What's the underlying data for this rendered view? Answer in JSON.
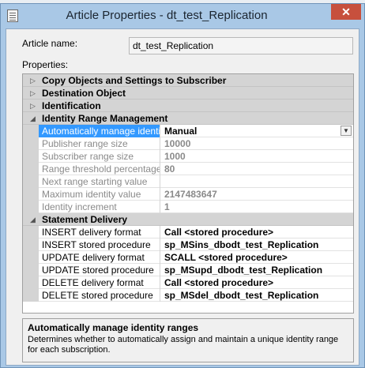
{
  "window": {
    "title": "Article Properties - dt_test_Replication",
    "close_label": "✕"
  },
  "form": {
    "article_name_label": "Article name:",
    "article_name_value": "dt_test_Replication",
    "properties_label": "Properties:"
  },
  "grid": {
    "categories": {
      "copy_objects": "Copy Objects and Settings to Subscriber",
      "destination_object": "Destination Object",
      "identification": "Identification",
      "identity_range": "Identity Range Management",
      "statement_delivery": "Statement Delivery"
    },
    "identity": [
      {
        "name": "Automatically manage identity ra",
        "value": "Manual"
      },
      {
        "name": "Publisher range size",
        "value": "10000"
      },
      {
        "name": "Subscriber range size",
        "value": "1000"
      },
      {
        "name": "Range threshold percentage",
        "value": "80"
      },
      {
        "name": "Next range starting value",
        "value": ""
      },
      {
        "name": "Maximum identity value",
        "value": "2147483647"
      },
      {
        "name": "Identity increment",
        "value": "1"
      }
    ],
    "statement": [
      {
        "name": "INSERT delivery format",
        "value": "Call <stored procedure>"
      },
      {
        "name": "INSERT stored procedure",
        "value": "sp_MSins_dbodt_test_Replication"
      },
      {
        "name": "UPDATE delivery format",
        "value": "SCALL <stored procedure>"
      },
      {
        "name": "UPDATE stored procedure",
        "value": "sp_MSupd_dbodt_test_Replication"
      },
      {
        "name": "DELETE delivery format",
        "value": "Call <stored procedure>"
      },
      {
        "name": "DELETE stored procedure",
        "value": "sp_MSdel_dbodt_test_Replication"
      }
    ]
  },
  "description": {
    "title": "Automatically manage identity ranges",
    "text": "Determines whether to automatically assign and maintain a unique identity range for each subscription."
  },
  "icons": {
    "collapsed": "triangle-right-icon",
    "expanded": "triangle-down-icon",
    "dropdown": "chevron-down-icon"
  }
}
